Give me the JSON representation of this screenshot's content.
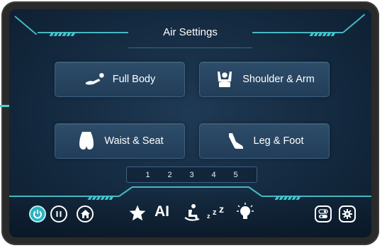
{
  "header": {
    "title": "Air Settings"
  },
  "modes": [
    {
      "label": "Full Body",
      "icon": "full-body-icon"
    },
    {
      "label": "Shoulder & Arm",
      "icon": "shoulder-arm-icon"
    },
    {
      "label": "Waist & Seat",
      "icon": "waist-seat-icon"
    },
    {
      "label": "Leg & Foot",
      "icon": "leg-foot-icon"
    }
  ],
  "levels": [
    "1",
    "2",
    "3",
    "4",
    "5"
  ],
  "toolbar": {
    "ai_label": "AI",
    "icons": [
      "power-icon",
      "pause-icon",
      "home-icon",
      "star-icon",
      "recline-icon",
      "sleep-icon",
      "light-icon",
      "toggle-icon",
      "settings-icon"
    ]
  },
  "colors": {
    "accent": "#4fd1d9",
    "power_active": "#2bb3c0",
    "panel": "#223d58"
  }
}
